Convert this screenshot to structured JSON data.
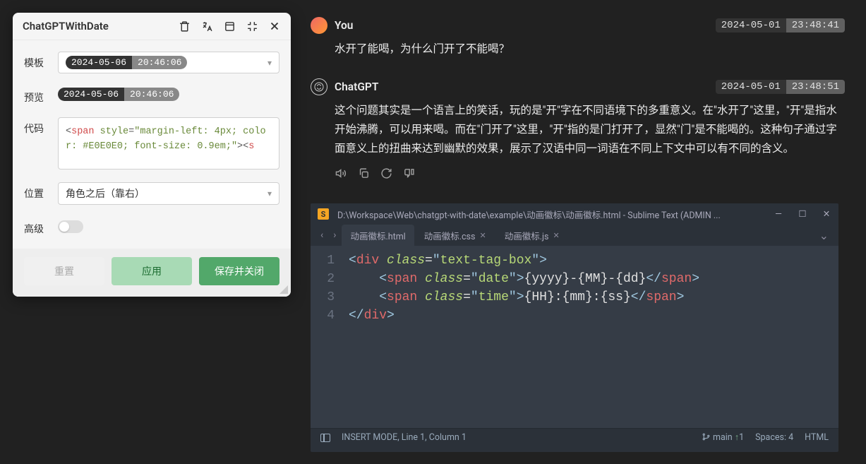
{
  "panel": {
    "title": "ChatGPTWithDate",
    "rows": {
      "template": {
        "label": "模板",
        "badge_date": "2024-05-06",
        "badge_time": "20:46:06"
      },
      "preview": {
        "label": "预览",
        "badge_date": "2024-05-06",
        "badge_time": "20:46:06"
      },
      "code": {
        "label": "代码",
        "snippet_prefix": "<",
        "snippet_tag": "span",
        "snippet_attr": "style",
        "snippet_val": "\"margin-left: 4px; color: #E0E0E0; font-size: 0.9em;\"",
        "snippet_suffix": "><",
        "snippet_tag2": "s"
      },
      "position": {
        "label": "位置",
        "value": "角色之后（靠右）"
      },
      "advanced": {
        "label": "高级"
      }
    },
    "footer": {
      "reset": "重置",
      "apply": "应用",
      "save": "保存并关闭"
    }
  },
  "chat": {
    "messages": [
      {
        "author": "You",
        "ts_date": "2024-05-01",
        "ts_time": "23:48:41",
        "body": "水开了能喝，为什么门开了不能喝？"
      },
      {
        "author": "ChatGPT",
        "ts_date": "2024-05-01",
        "ts_time": "23:48:51",
        "body": "这个问题其实是一个语言上的笑话，玩的是\"开\"字在不同语境下的多重意义。在\"水开了\"这里，\"开\"是指水开始沸腾，可以用来喝。而在\"门开了\"这里，\"开\"指的是门打开了，显然\"门\"是不能喝的。这种句子通过字面意义上的扭曲来达到幽默的效果，展示了汉语中同一词语在不同上下文中可以有不同的含义。"
      }
    ]
  },
  "editor": {
    "title": "D:\\Workspace\\Web\\chatgpt-with-date\\example\\动画徽标\\动画徽标.html - Sublime Text (ADMIN ...",
    "tabs": [
      {
        "name": "动画徽标.html",
        "active": true
      },
      {
        "name": "动画徽标.css",
        "active": false
      },
      {
        "name": "动画徽标.js",
        "active": false
      }
    ],
    "status": {
      "mode": "INSERT MODE, Line 1, Column 1",
      "branch": "main",
      "branch_count": "1",
      "spaces": "Spaces: 4",
      "lang": "HTML"
    },
    "code_lines": [
      "1",
      "2",
      "3",
      "4"
    ]
  }
}
